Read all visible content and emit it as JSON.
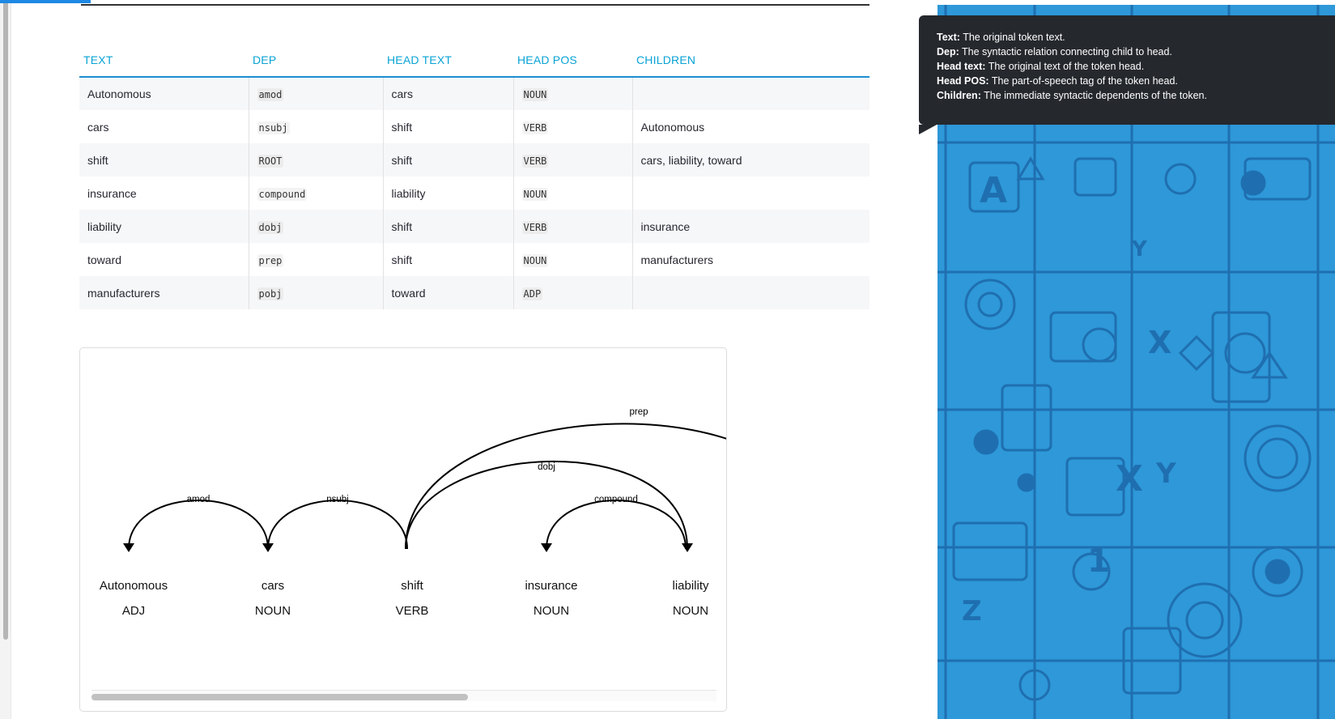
{
  "table": {
    "headers": [
      "TEXT",
      "DEP",
      "HEAD TEXT",
      "HEAD POS",
      "CHILDREN"
    ],
    "rows": [
      {
        "text": "Autonomous",
        "dep": "amod",
        "head_text": "cars",
        "head_pos": "NOUN",
        "children": ""
      },
      {
        "text": "cars",
        "dep": "nsubj",
        "head_text": "shift",
        "head_pos": "VERB",
        "children": "Autonomous"
      },
      {
        "text": "shift",
        "dep": "ROOT",
        "head_text": "shift",
        "head_pos": "VERB",
        "children": "cars, liability, toward"
      },
      {
        "text": "insurance",
        "dep": "compound",
        "head_text": "liability",
        "head_pos": "NOUN",
        "children": ""
      },
      {
        "text": "liability",
        "dep": "dobj",
        "head_text": "shift",
        "head_pos": "VERB",
        "children": "insurance"
      },
      {
        "text": "toward",
        "dep": "prep",
        "head_text": "shift",
        "head_pos": "NOUN",
        "children": "manufacturers"
      },
      {
        "text": "manufacturers",
        "dep": "pobj",
        "head_text": "toward",
        "head_pos": "ADP",
        "children": ""
      }
    ]
  },
  "parse": {
    "tokens": [
      {
        "word": "Autonomous",
        "tag": "ADJ"
      },
      {
        "word": "cars",
        "tag": "NOUN"
      },
      {
        "word": "shift",
        "tag": "VERB"
      },
      {
        "word": "insurance",
        "tag": "NOUN"
      },
      {
        "word": "liability",
        "tag": "NOUN"
      }
    ],
    "arcs": [
      {
        "label": "amod",
        "from": 0,
        "to": 1,
        "dir": "left"
      },
      {
        "label": "nsubj",
        "from": 1,
        "to": 2,
        "dir": "left"
      },
      {
        "label": "compound",
        "from": 3,
        "to": 4,
        "dir": "left"
      },
      {
        "label": "dobj",
        "from": 2,
        "to": 4,
        "dir": "right"
      },
      {
        "label": "prep",
        "from": 2,
        "to": 5,
        "dir": "right"
      }
    ]
  },
  "tooltip": {
    "lines": [
      {
        "term": "Text:",
        "desc": "The original token text."
      },
      {
        "term": "Dep:",
        "desc": "The syntactic relation connecting child to head."
      },
      {
        "term": "Head text:",
        "desc": "The original text of the token head."
      },
      {
        "term": "Head POS:",
        "desc": "The part-of-speech tag of the token head."
      },
      {
        "term": "Children:",
        "desc": "The immediate syntactic dependents of the token."
      }
    ]
  },
  "colors": {
    "accent": "#09a3d5",
    "panel": "#2e98d8",
    "tooltip_bg": "#25282d"
  },
  "decor_icons": [
    "letter-a-icon",
    "letter-x-icon",
    "letter-y-icon",
    "letter-z-icon",
    "number-1-icon",
    "gear-icon",
    "chip-icon",
    "phone-icon",
    "chat-bubble-icon",
    "lightbulb-icon",
    "triangle-icon",
    "hexagon-icon",
    "target-icon",
    "network-icon"
  ]
}
